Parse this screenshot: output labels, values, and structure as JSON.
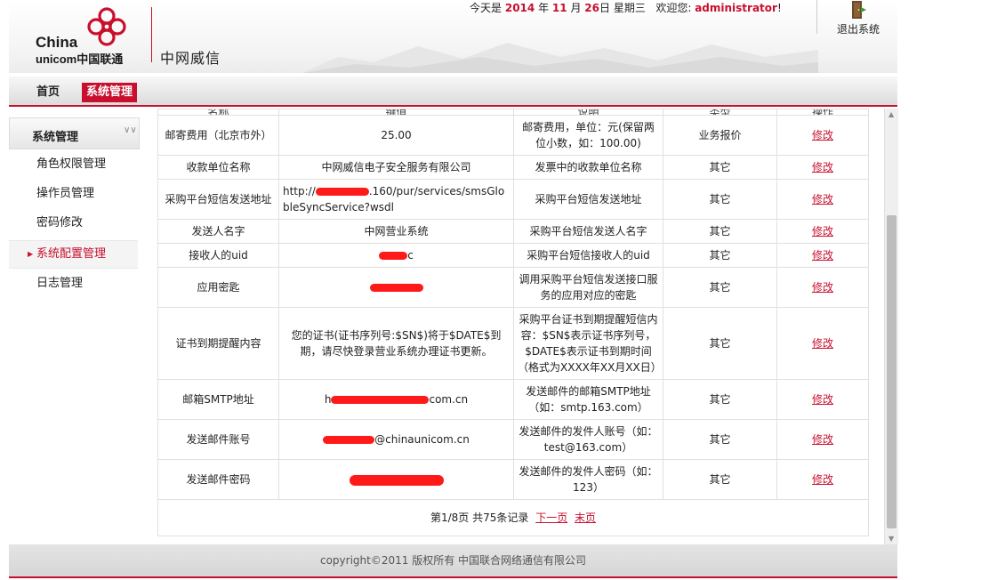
{
  "header": {
    "logo_en_top": "China",
    "logo_en_bottom": "unicom中国联通",
    "brand": "中网威信",
    "date": {
      "prefix": "今天是",
      "year": "2014",
      "year_unit": "年",
      "month": "11",
      "month_unit": "月",
      "day": "26",
      "day_unit": "日",
      "weekday": "星期三",
      "welcome": "欢迎您:",
      "user": "administrator",
      "exclaim": "!"
    },
    "logout_label": "退出系统"
  },
  "nav": {
    "home": "首页",
    "system": "系统管理"
  },
  "sidebar": {
    "title": "系统管理",
    "collapse_icon": "double-chevron-down-icon",
    "items": [
      {
        "label": "角色权限管理",
        "active": false
      },
      {
        "label": "操作员管理",
        "active": false
      },
      {
        "label": "密码修改",
        "active": false
      },
      {
        "label": "系统配置管理",
        "active": true
      },
      {
        "label": "日志管理",
        "active": false
      }
    ]
  },
  "table": {
    "columns": [
      "名称",
      "键值",
      "说明",
      "类型",
      "操作"
    ],
    "rows": [
      {
        "name": "邮寄费用（北京市外）",
        "value": "25.00",
        "desc": "邮寄费用，单位：元(保留两位小数，如：100.00)",
        "type": "业务报价",
        "action": "修改"
      },
      {
        "name": "收款单位名称",
        "value": "中网威信电子安全服务有限公司",
        "desc": "发票中的收款单位名称",
        "type": "其它",
        "action": "修改"
      },
      {
        "name": "采购平台短信发送地址",
        "value_prefix": "http://",
        "value_suffix": ".160/pur/services/smsGlobleSyncService?wsdl",
        "desc": "采购平台短信发送地址",
        "type": "其它",
        "action": "修改"
      },
      {
        "name": "发送人名字",
        "value": "中网营业系统",
        "desc": "采购平台短信发送人名字",
        "type": "其它",
        "action": "修改"
      },
      {
        "name": "接收人的uid",
        "value_suffix": "c",
        "desc": "采购平台短信接收人的uid",
        "type": "其它",
        "action": "修改"
      },
      {
        "name": "应用密匙",
        "value": "",
        "desc": "调用采购平台短信发送接口服务的应用对应的密匙",
        "type": "其它",
        "action": "修改"
      },
      {
        "name": "证书到期提醒内容",
        "value": "您的证书(证书序列号:$SN$)将于$DATE$到期，请尽快登录营业系统办理证书更新。",
        "desc": "采购平台证书到期提醒短信内容：$SN$表示证书序列号，$DATE$表示证书到期时间（格式为XXXX年XX月XX日）",
        "type": "其它",
        "action": "修改"
      },
      {
        "name": "邮箱SMTP地址",
        "value_prefix": "h",
        "value_suffix": "com.cn",
        "desc": "发送邮件的邮箱SMTP地址（如：smtp.163.com）",
        "type": "其它",
        "action": "修改"
      },
      {
        "name": "发送邮件账号",
        "value_suffix": "@chinaunicom.cn",
        "desc": "发送邮件的发件人账号（如：test@163.com）",
        "type": "其它",
        "action": "修改"
      },
      {
        "name": "发送邮件密码",
        "value": "",
        "desc": "发送邮件的发件人密码（如：123）",
        "type": "其它",
        "action": "修改"
      }
    ],
    "pager": {
      "info": "第1/8页 共75条记录",
      "next": "下一页",
      "last": "末页"
    }
  },
  "footer": {
    "copyright": "copyright©2011 版权所有 中国联合网络通信有限公司"
  },
  "colors": {
    "accent": "#c8102e",
    "redaction": "#ff1a1a"
  }
}
